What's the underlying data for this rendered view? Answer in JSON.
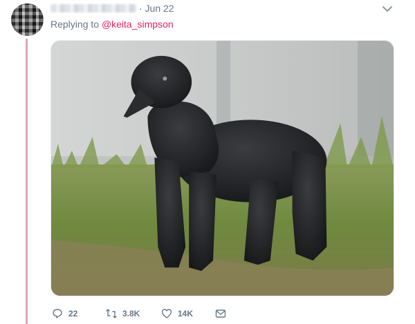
{
  "tweet": {
    "date": "· Jun 22",
    "replying_prefix": "Replying to ",
    "replying_handle": "@keita_simpson"
  },
  "actions": {
    "reply_count": "22",
    "retweet_count": "3.8K",
    "like_count": "14K"
  },
  "icons": {
    "reply": "reply-icon",
    "retweet": "retweet-icon",
    "like": "heart-icon",
    "dm": "envelope-icon",
    "more": "chevron-down-icon"
  },
  "colors": {
    "accent": "#e0245e",
    "muted": "#657786",
    "thread_line": "#d7a7b7"
  }
}
